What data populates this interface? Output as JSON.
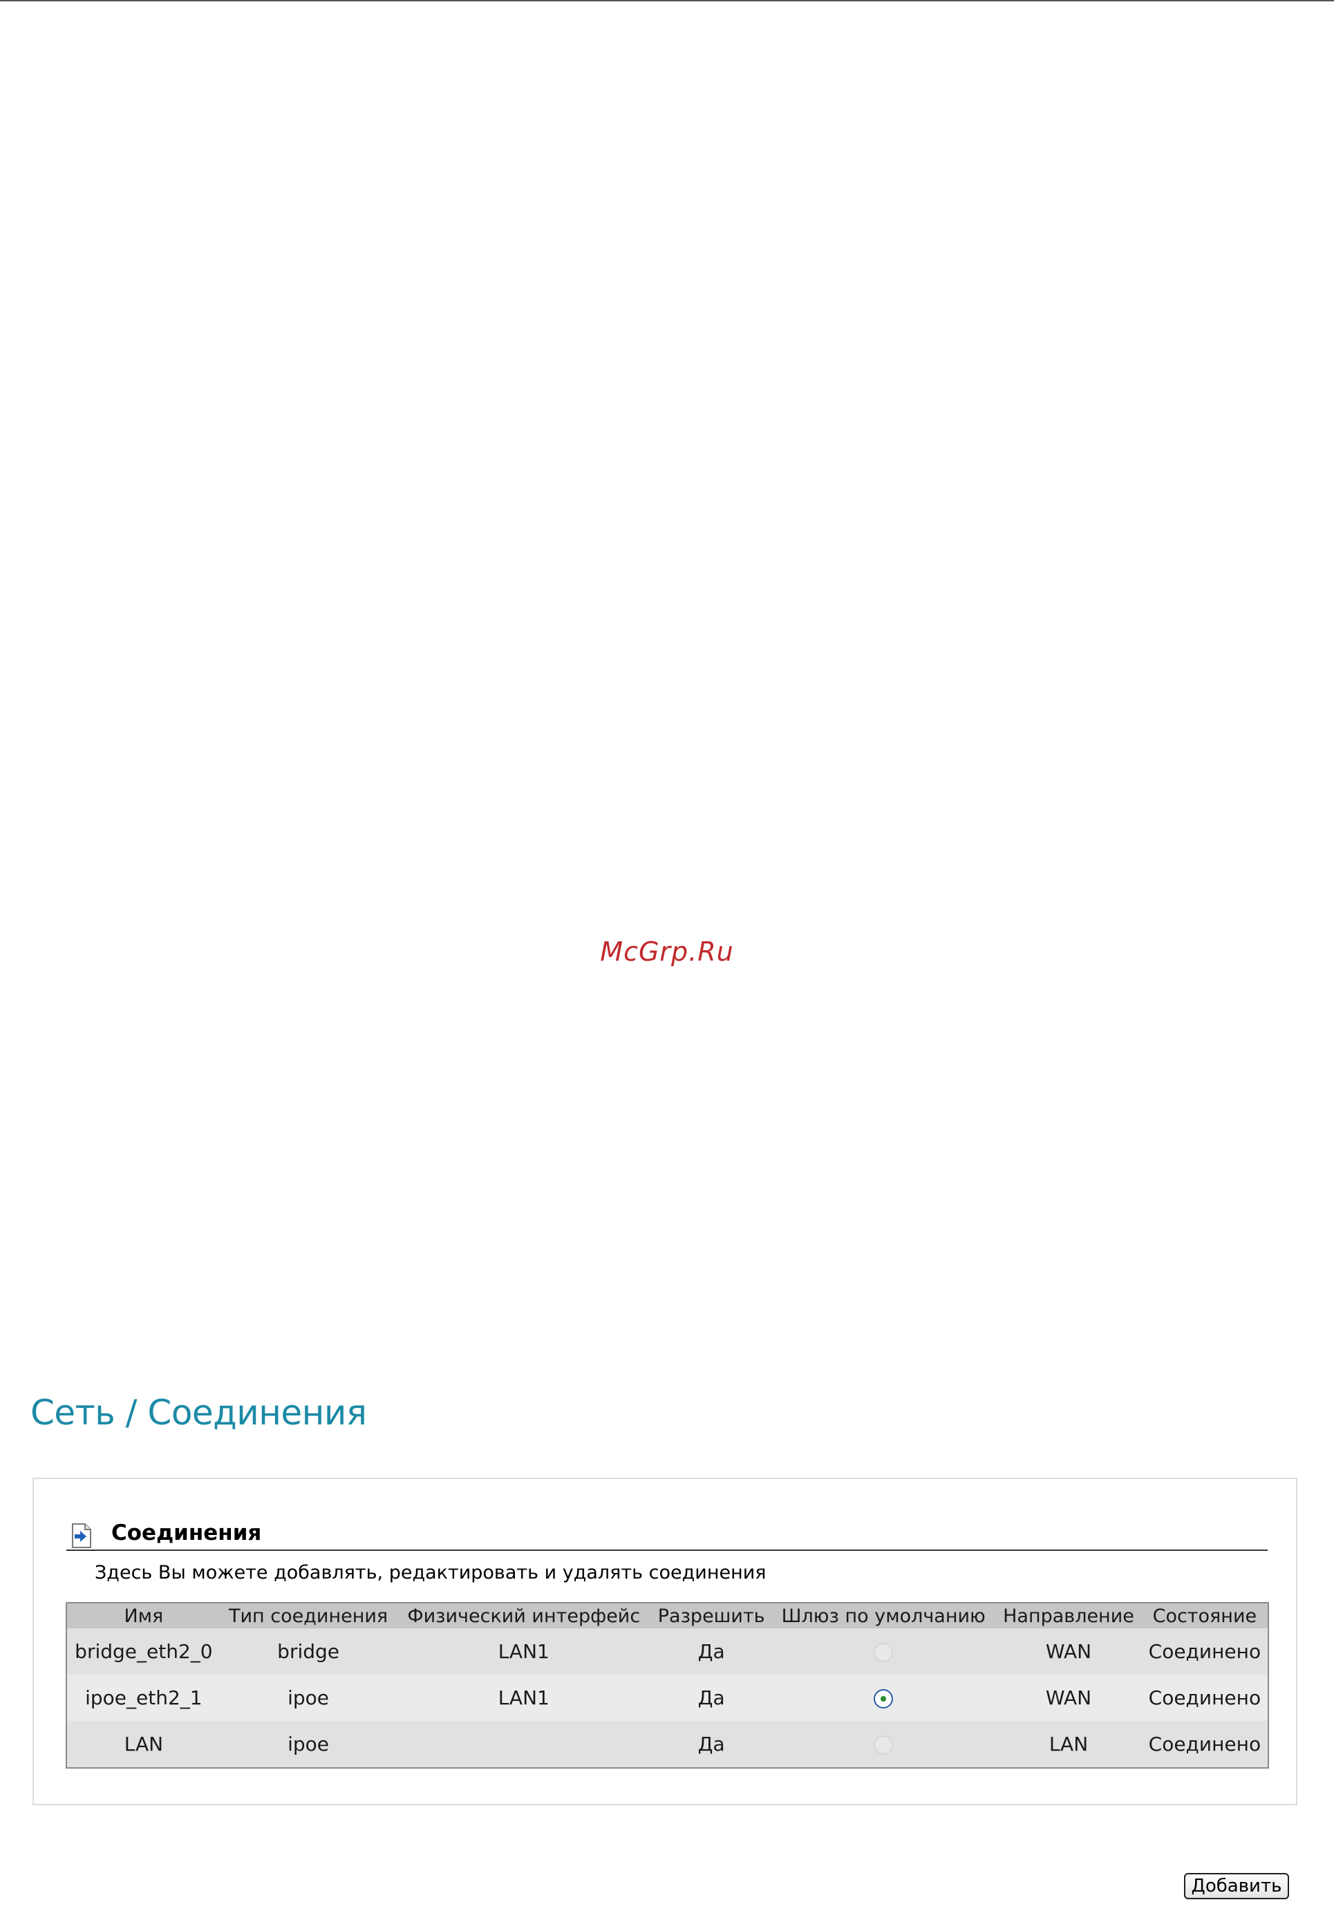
{
  "watermark": "McGrp.Ru",
  "page": {
    "title": "Сеть / Соединения"
  },
  "section": {
    "title": "Соединения",
    "description": "Здесь Вы можете добавлять, редактировать и удалять соединения",
    "icon": "page-arrow-icon"
  },
  "table": {
    "headers": [
      "Имя",
      "Тип соединения",
      "Физический интерфейс",
      "Разрешить",
      "Шлюз по умолчанию",
      "Направление",
      "Состояние"
    ],
    "rows": [
      {
        "name": "bridge_eth2_0",
        "type": "bridge",
        "interface": "LAN1",
        "enabled": "Да",
        "default_gateway": false,
        "direction": "WAN",
        "status": "Соединено"
      },
      {
        "name": "ipoe_eth2_1",
        "type": "ipoe",
        "interface": "LAN1",
        "enabled": "Да",
        "default_gateway": true,
        "direction": "WAN",
        "status": "Соединено"
      },
      {
        "name": "LAN",
        "type": "ipoe",
        "interface": "",
        "enabled": "Да",
        "default_gateway": false,
        "direction": "LAN",
        "status": "Соединено"
      }
    ]
  },
  "actions": {
    "add_label": "Добавить"
  },
  "colors": {
    "title": "#1b8aa6",
    "watermark": "#c0282b",
    "header_bg": "#c6c6c6"
  }
}
